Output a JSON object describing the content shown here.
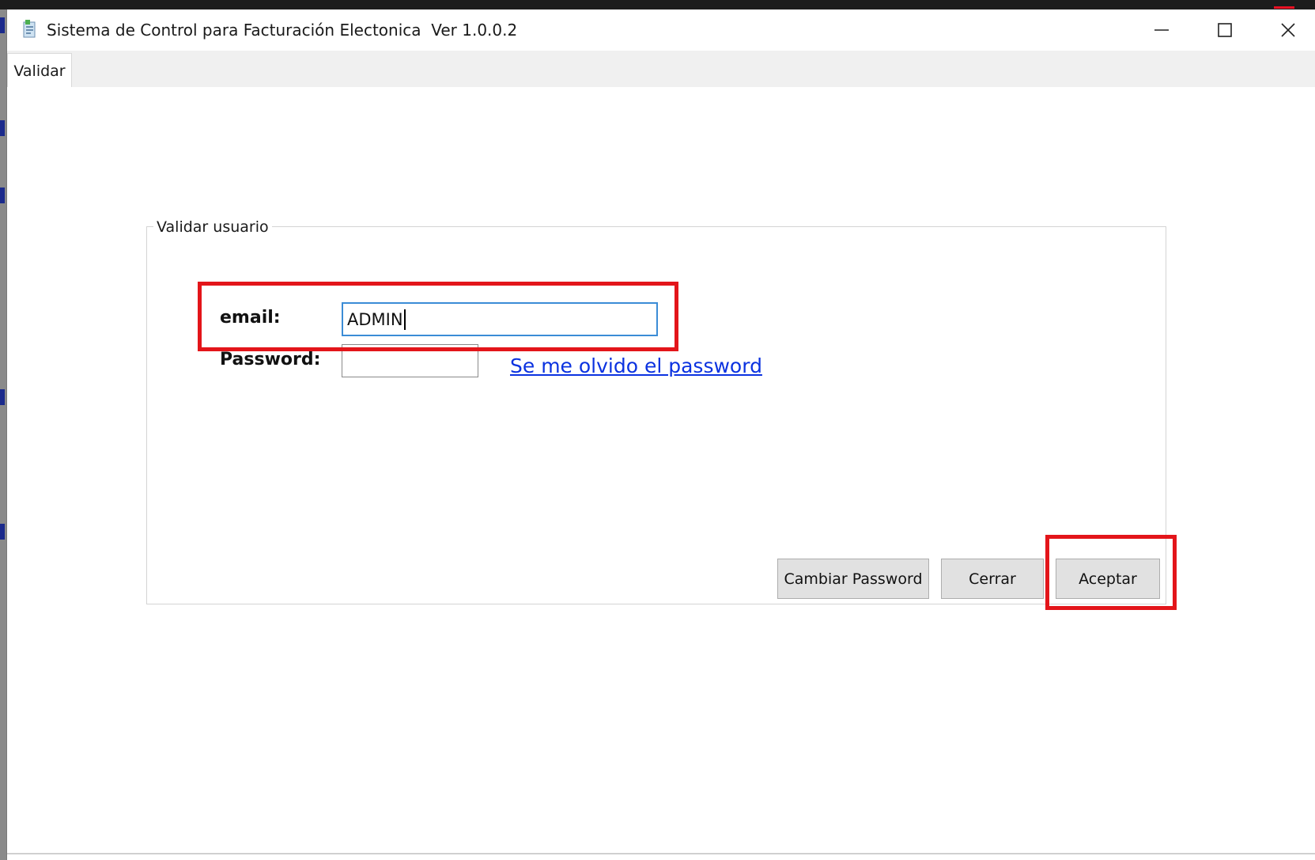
{
  "window": {
    "title": "Sistema de Control para Facturación Electonica  Ver 1.0.0.2",
    "controls": [
      "minimize-icon",
      "maximize-icon",
      "close-icon"
    ]
  },
  "tabs": [
    {
      "label": "Validar",
      "active": true
    }
  ],
  "group": {
    "title": "Validar usuario"
  },
  "form": {
    "email_label": "email:",
    "email_value": "ADMIN",
    "password_label": "Password:",
    "password_value": "",
    "forgot_link": "Se me olvido el password"
  },
  "buttons": {
    "change_password": "Cambiar Password",
    "close": "Cerrar",
    "accept": "Aceptar"
  },
  "colors": {
    "highlight": "#e3151a",
    "link": "#0b32e0",
    "focus_border": "#3b8cd6"
  }
}
